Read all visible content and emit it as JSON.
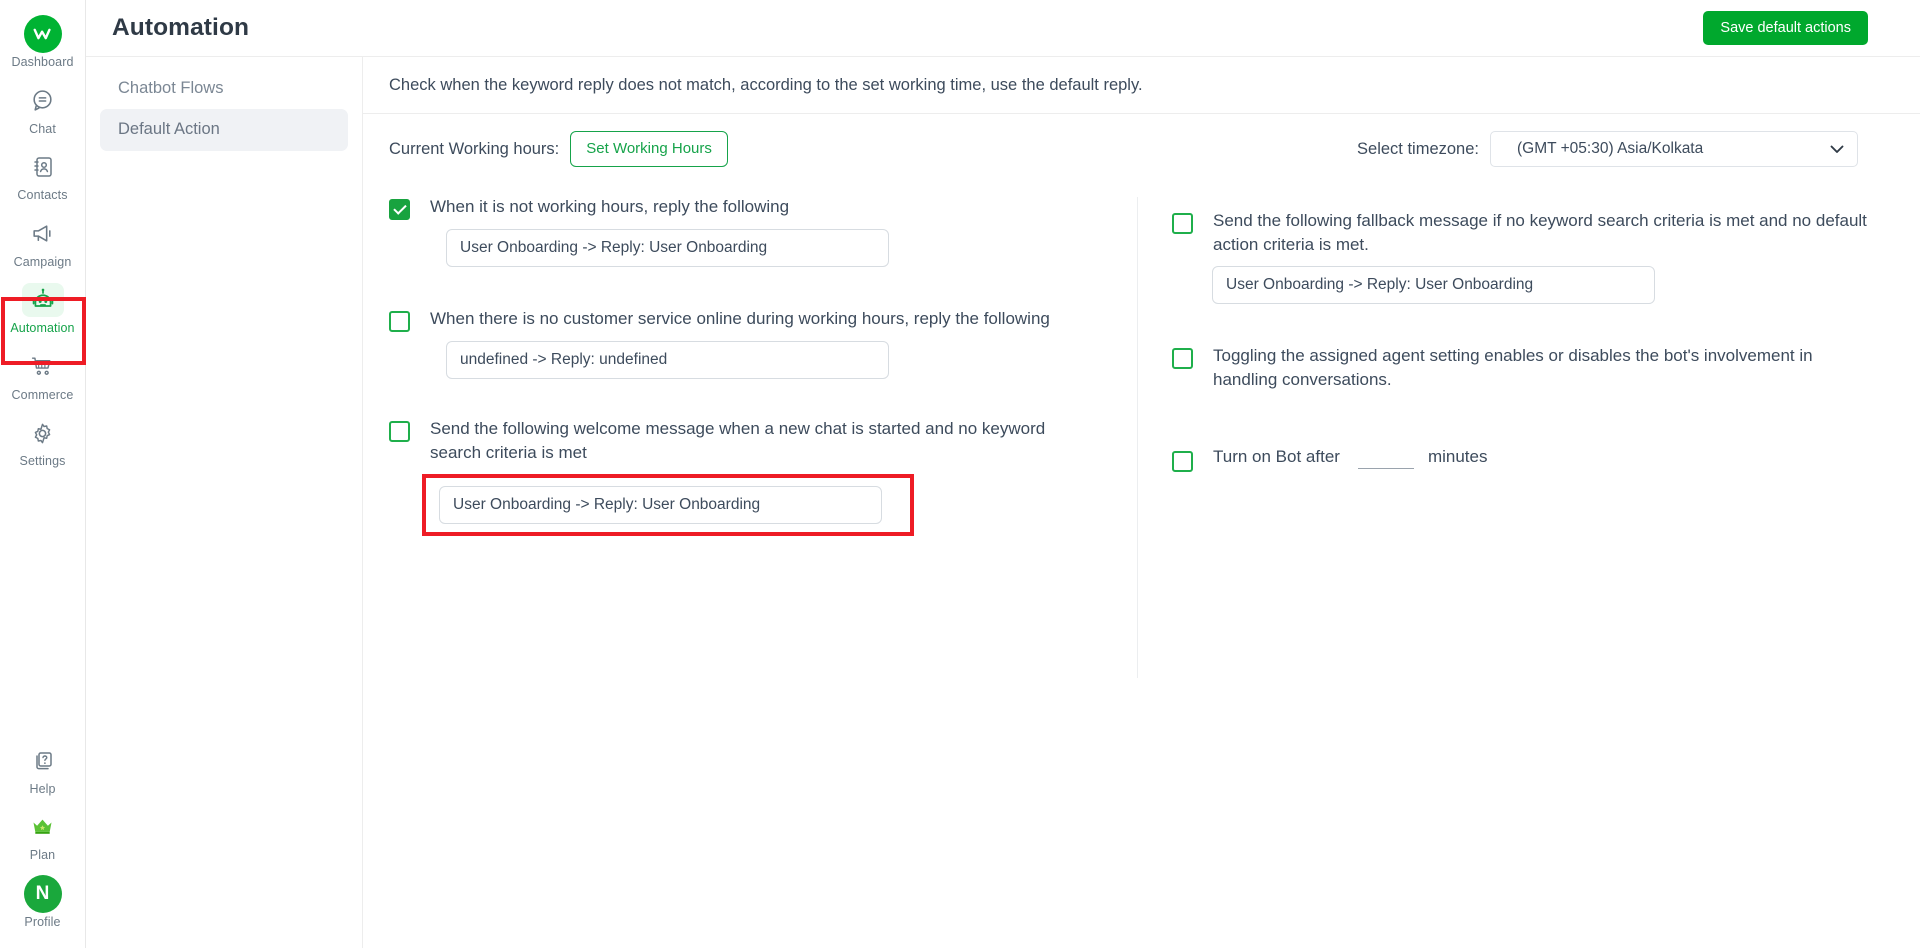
{
  "rail": {
    "top_items": [
      {
        "label": "Dashboard",
        "icon": "app-logo-icon",
        "active": false
      },
      {
        "label": "Chat",
        "icon": "chat-bubble-icon",
        "active": false
      },
      {
        "label": "Contacts",
        "icon": "contacts-book-icon",
        "active": false
      },
      {
        "label": "Campaign",
        "icon": "megaphone-icon",
        "active": false
      },
      {
        "label": "Automation",
        "icon": "robot-icon",
        "active": true
      },
      {
        "label": "Commerce",
        "icon": "shopping-cart-icon",
        "active": false
      },
      {
        "label": "Settings",
        "icon": "gear-icon",
        "active": false
      }
    ],
    "bottom_items": [
      {
        "label": "Help",
        "icon": "help-question-icon"
      },
      {
        "label": "Plan",
        "icon": "crown-icon"
      },
      {
        "label": "Profile",
        "icon": "avatar-icon",
        "avatar_initial": "N"
      }
    ]
  },
  "header": {
    "title": "Automation",
    "save_button": "Save default actions"
  },
  "subnav": {
    "items": [
      {
        "label": "Chatbot Flows",
        "active": false
      },
      {
        "label": "Default Action",
        "active": true
      }
    ]
  },
  "main": {
    "hint": "Check when the keyword reply does not match, according to the set working time, use the default reply.",
    "working_hours_label": "Current Working hours:",
    "set_working_hours_button": "Set Working Hours",
    "timezone_label": "Select timezone:",
    "timezone_value": "(GMT +05:30) Asia/Kolkata"
  },
  "left_column": {
    "options": [
      {
        "checked": true,
        "text": "When it is not working hours, reply the following",
        "field_value": "User Onboarding -> Reply: User Onboarding",
        "highlighted": false
      },
      {
        "checked": false,
        "text": "When there is no customer service online during working hours, reply the following",
        "field_value": "undefined -> Reply: undefined",
        "highlighted": false
      },
      {
        "checked": false,
        "text": "Send the following welcome message when a new chat is started and no keyword search criteria is met",
        "field_value": "User Onboarding -> Reply: User Onboarding",
        "highlighted": true
      }
    ]
  },
  "right_column": {
    "options": [
      {
        "checked": false,
        "text": "Send the following fallback message if no keyword search criteria is met and no default action criteria is met.",
        "field_value": "User Onboarding -> Reply: User Onboarding"
      },
      {
        "checked": false,
        "text": "Toggling the assigned agent setting enables or disables the bot's involvement in handling conversations."
      }
    ],
    "bot_timer": {
      "checked": false,
      "prefix": "Turn on Bot after",
      "value": "",
      "suffix": "minutes"
    }
  },
  "colors": {
    "brand_green": "#00a82d",
    "accent_green": "#16a34a",
    "highlight_red": "#ee1c25",
    "text": "#3d4b5c"
  }
}
